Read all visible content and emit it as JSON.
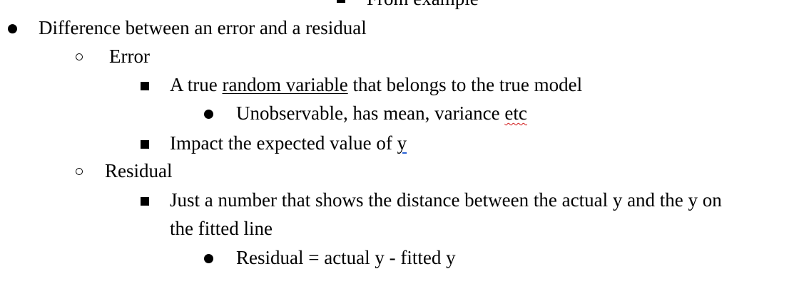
{
  "document": {
    "cut_off_top": {
      "text": "From example"
    },
    "items": [
      {
        "text": "Difference between an error and a residual"
      },
      {
        "text": "Error"
      },
      {
        "pre": "A true ",
        "link": "random variable",
        "post": " that belongs to the true model"
      },
      {
        "pre": "Unobservable, has mean, variance ",
        "flagged": "etc"
      },
      {
        "pre": "Impact the expected value of ",
        "flagged": "y"
      },
      {
        "text": "Residual"
      },
      {
        "line1": "Just a number that shows the distance between the actual y and the y on",
        "line2": "the fitted line"
      },
      {
        "text": "Residual = actual y - fitted y"
      }
    ]
  }
}
